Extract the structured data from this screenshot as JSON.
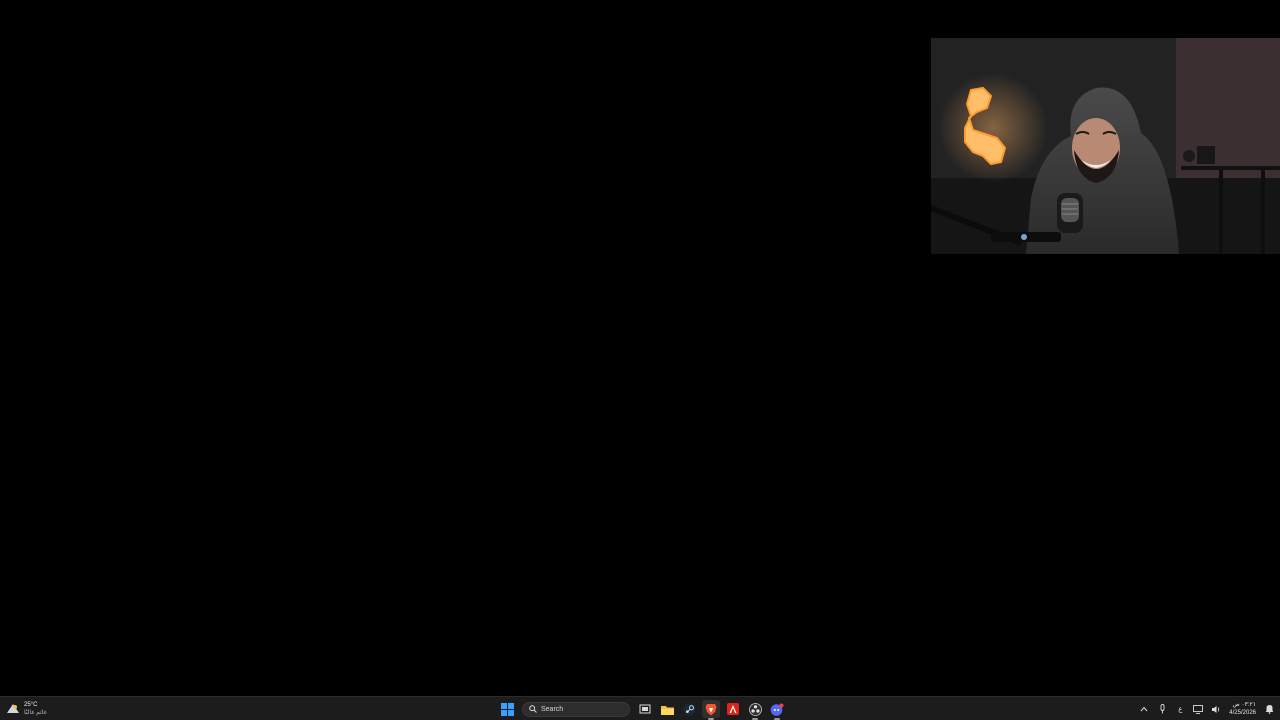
{
  "weather": {
    "icon": "cloud-sun-icon",
    "temperature": "25°C",
    "condition": "غائم غالبًا"
  },
  "taskbar": {
    "search_label": "Search",
    "apps": [
      {
        "name": "start-button",
        "icon": "windows-logo-icon"
      },
      {
        "name": "task-view-button",
        "icon": "task-view-icon"
      },
      {
        "name": "file-explorer-button",
        "icon": "folder-icon"
      },
      {
        "name": "steam-button",
        "icon": "steam-icon"
      },
      {
        "name": "brave-browser-button",
        "icon": "brave-lion-icon"
      },
      {
        "name": "adobe-acrobat-button",
        "icon": "acrobat-icon"
      },
      {
        "name": "obs-button",
        "icon": "obs-icon"
      },
      {
        "name": "discord-button",
        "icon": "discord-icon"
      }
    ]
  },
  "tray": {
    "language": "ع",
    "time": "٠٣:٢١ ص",
    "date": "4/25/2026"
  },
  "colors": {
    "taskbar_bg": "#1c1c1c",
    "accent_blue": "#3aa0ff",
    "brave_orange": "#fb542b",
    "acrobat_red": "#e2231a",
    "discord_blurple": "#5865f2"
  }
}
